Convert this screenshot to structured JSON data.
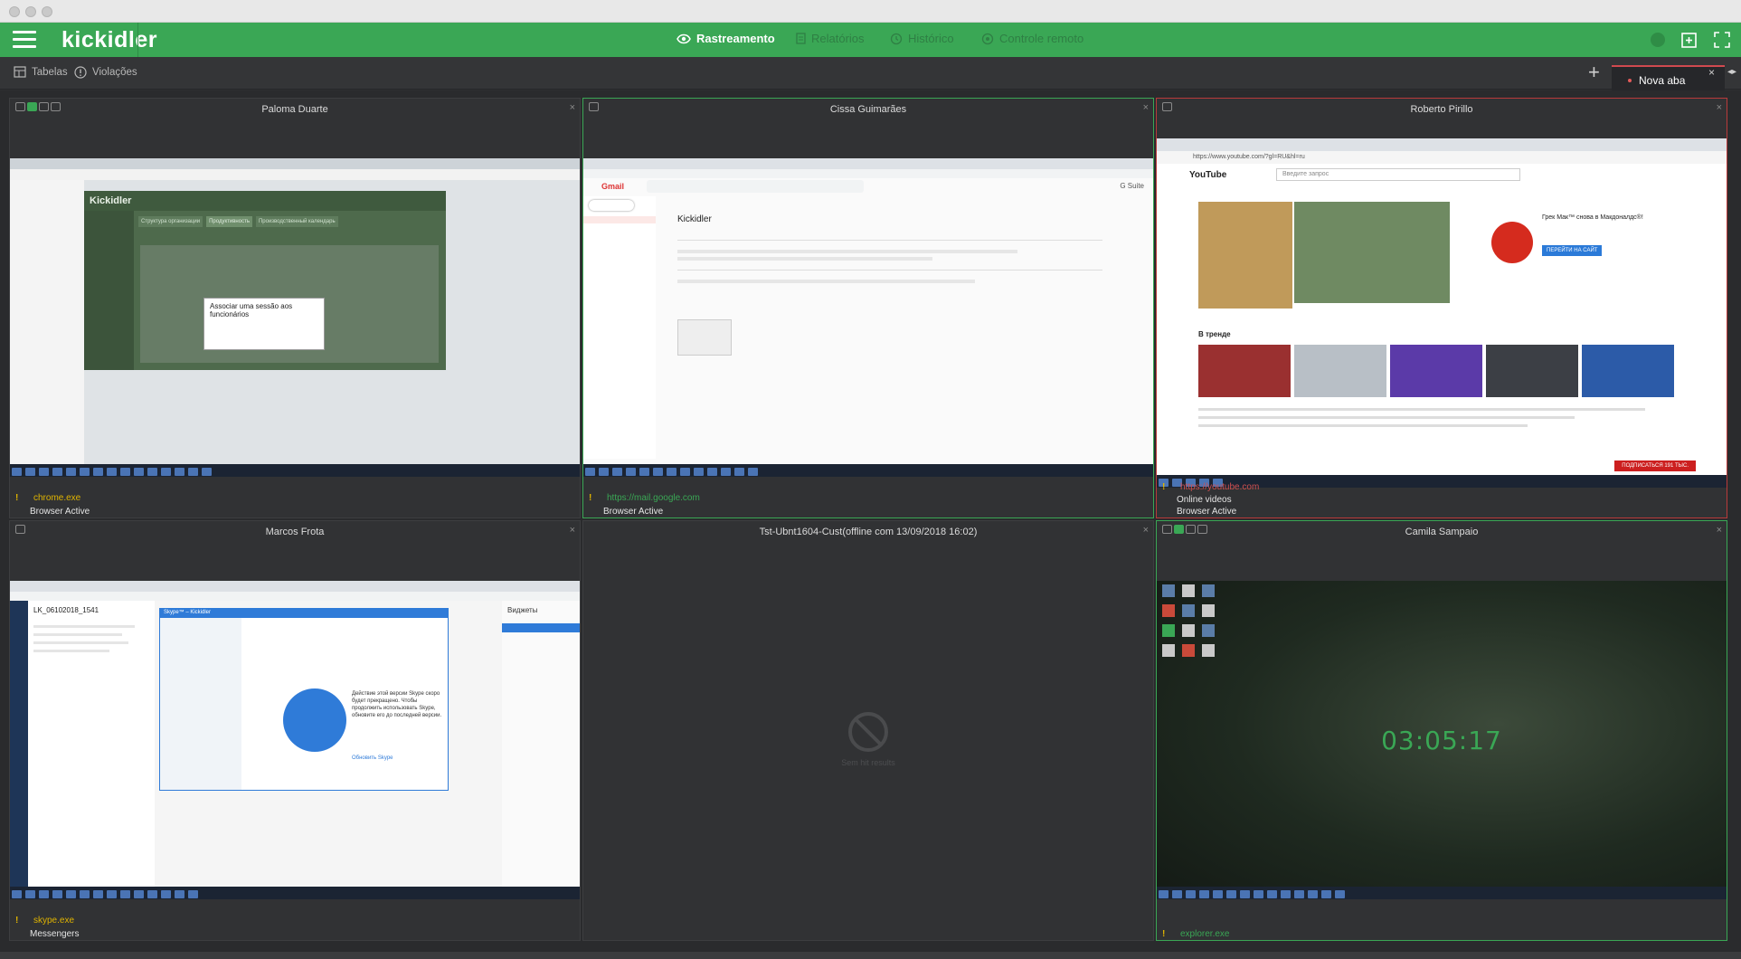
{
  "header": {
    "logo": "kickidler",
    "nav": [
      {
        "label": "Rastreamento",
        "icon": "eye-icon",
        "active": true
      },
      {
        "label": "Relatórios",
        "icon": "report-icon",
        "active": false
      },
      {
        "label": "Histórico",
        "icon": "history-icon",
        "active": false
      },
      {
        "label": "Controle remoto",
        "icon": "remote-icon",
        "active": false
      }
    ]
  },
  "toolbar": {
    "tables_label": "Tabelas",
    "violations_label": "Violações",
    "add_tab": "+",
    "active_tab": "Nova aba",
    "close_tab": "×"
  },
  "panels": [
    {
      "title": "Paloma Duarte",
      "process": "chrome.exe",
      "category": "Browser Active",
      "screen_text": {
        "app": "Kickidler",
        "tabs": [
          "Структура организации",
          "Продуктивность",
          "Производственный календарь"
        ],
        "dialog_title": "Associar uma sessão aos funcionários"
      }
    },
    {
      "title": "Cissa Guimarães",
      "process": "https://mail.google.com",
      "category": "Browser Active",
      "screen_text": {
        "app": "Gmail",
        "subject": "Kickidler",
        "badge": "G Suite"
      }
    },
    {
      "title": "Roberto Pirillo",
      "process": "https://youtube.com",
      "category": "Online videos",
      "category2": "Browser Active",
      "screen_text": {
        "app": "YouTube",
        "url": "https://www.youtube.com/?gl=RU&hl=ru",
        "search": "Введите запрос",
        "section": "В тренде",
        "ad_title": "Грек Мак™ снова в Макдоналдс®!",
        "ad_button": "ПЕРЕЙТИ НА САЙТ",
        "subscribe": "ПОДПИСАТЬСЯ 191 ТЫС."
      }
    },
    {
      "title": "Marcos Frota",
      "process": "skype.exe",
      "category": "Messengers",
      "screen_text": {
        "header": "LK_06102018_1541",
        "dialog": "Skype™ – Kickidler",
        "update_msg": "Действие этой версии Skype скоро будет прекращено. Чтобы продолжить использовать Skype, обновите его до последней версии.",
        "update_link": "Обновить Skype",
        "widgets": "Виджеты"
      }
    },
    {
      "title": "Tst-Ubnt1604-Cust(offline com 13/09/2018 16:02)",
      "process": "",
      "category": "",
      "screen_text": {
        "no_results": "Sem hit results"
      }
    },
    {
      "title": "Camila Sampaio",
      "process": "explorer.exe",
      "category": "",
      "screen_text": {
        "clock": "03:05:17"
      }
    }
  ],
  "colors": {
    "accent": "#3aa755",
    "warning": "#e0b400",
    "error": "#b93a3a"
  }
}
